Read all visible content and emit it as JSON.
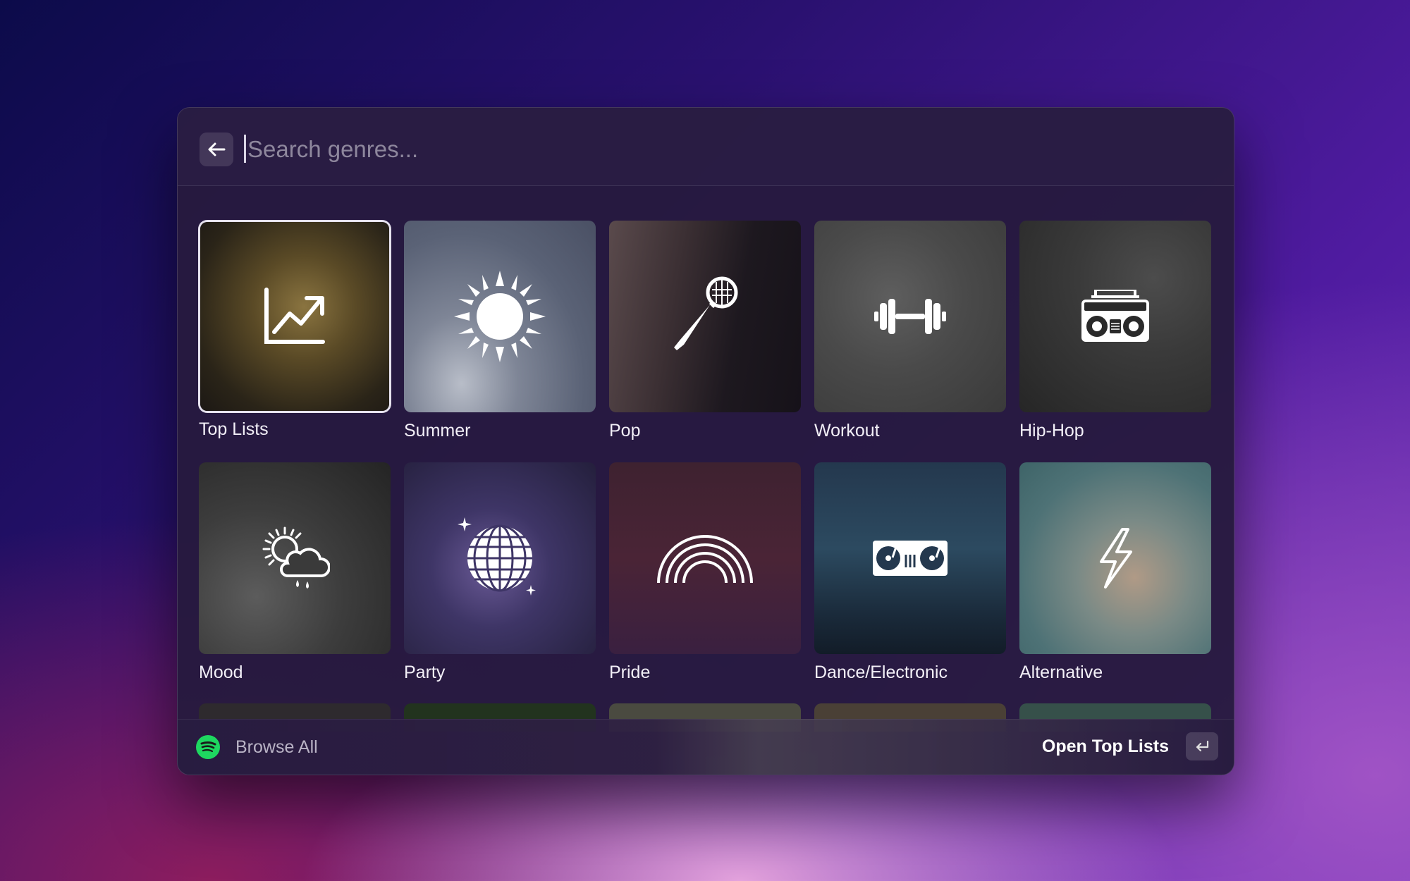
{
  "search": {
    "placeholder": "Search genres..."
  },
  "genres": [
    {
      "label": "Top Lists",
      "icon": "trending-up-icon",
      "selected": true
    },
    {
      "label": "Summer",
      "icon": "sun-icon"
    },
    {
      "label": "Pop",
      "icon": "microphone-icon"
    },
    {
      "label": "Workout",
      "icon": "dumbbell-icon"
    },
    {
      "label": "Hip-Hop",
      "icon": "boombox-icon"
    },
    {
      "label": "Mood",
      "icon": "weather-sun-cloud-rain-icon"
    },
    {
      "label": "Party",
      "icon": "disco-ball-icon"
    },
    {
      "label": "Pride",
      "icon": "rainbow-icon"
    },
    {
      "label": "Dance/Electronic",
      "icon": "dj-turntables-icon"
    },
    {
      "label": "Alternative",
      "icon": "lightning-bolt-icon"
    }
  ],
  "footer": {
    "left_label": "Browse All",
    "right_label": "Open Top Lists",
    "enter_key": "↵"
  },
  "colors": {
    "spotify_green": "#1ed760",
    "selected_border": "#e6e2ee"
  }
}
